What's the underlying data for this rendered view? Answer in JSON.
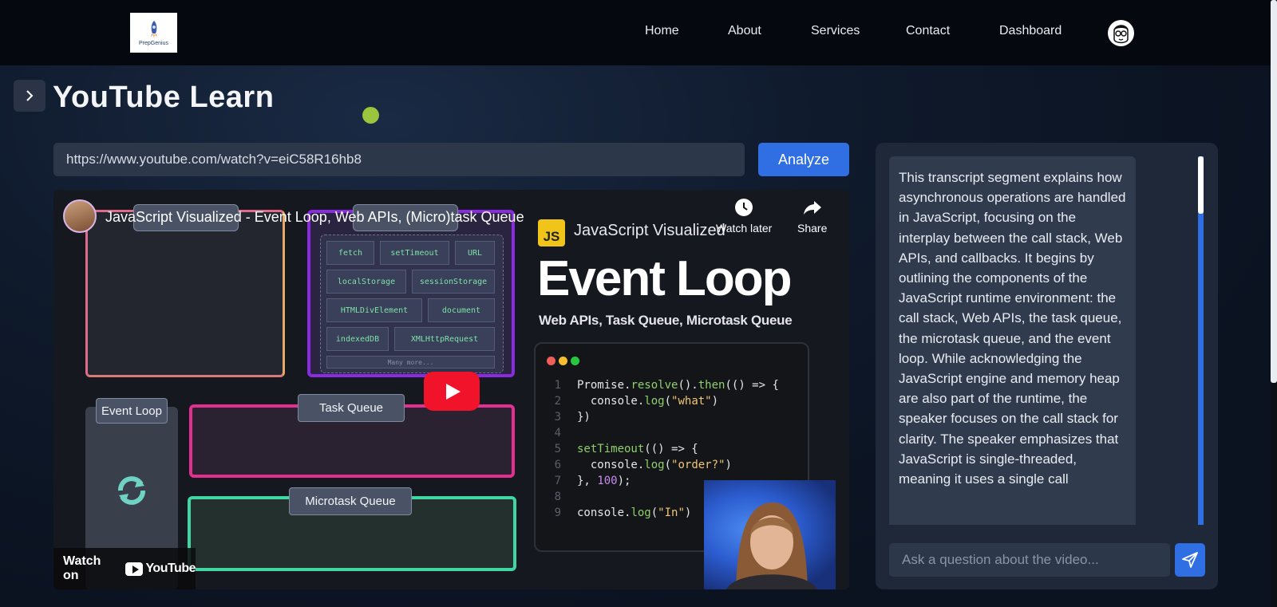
{
  "nav": {
    "logo_text": "PrepGenius",
    "links": [
      "Home",
      "About",
      "Services",
      "Contact",
      "Dashboard"
    ]
  },
  "page": {
    "title": "YouTube Learn"
  },
  "url_bar": {
    "value": "https://www.youtube.com/watch?v=eiC58R16hb8",
    "analyze_label": "Analyze"
  },
  "video": {
    "title": "JavaScript Visualized - Event Loop, Web APIs, (Micro)task Queue",
    "watch_later_label": "Watch later",
    "share_label": "Share",
    "watch_on_label": "Watch on",
    "youtube_label": "YouTube",
    "thumbnail": {
      "event_loop_label": "Event Loop",
      "task_queue_label": "Task Queue",
      "microtask_queue_label": "Microtask Queue",
      "apis": [
        "fetch",
        "setTimeout",
        "URL",
        "localStorage",
        "sessionStorage",
        "HTMLDivElement",
        "document",
        "indexedDB",
        "XMLHttpRequest",
        "Many more..."
      ],
      "js_badge": "JS",
      "series_label": "JavaScript Visualized",
      "headline": "Event Loop",
      "subheadline": "Web APIs, Task Queue, Microtask Queue"
    }
  },
  "chat": {
    "transcript": "This transcript segment explains how asynchronous operations are handled in JavaScript, focusing on the interplay between the call stack, Web APIs, and callbacks. It begins by outlining the components of the JavaScript runtime environment: the call stack, Web APIs, the task queue, the microtask queue, and the event loop. While acknowledging the JavaScript engine and memory heap are also part of the runtime, the speaker focuses on the call stack for clarity. The speaker emphasizes that JavaScript is single-threaded, meaning it uses a single call",
    "ask_placeholder": "Ask a question about the video..."
  },
  "colors": {
    "accent": "#2f6fe3",
    "background": "#0d1422",
    "panel": "#1e2838",
    "green_dot": "#9bc53d"
  }
}
